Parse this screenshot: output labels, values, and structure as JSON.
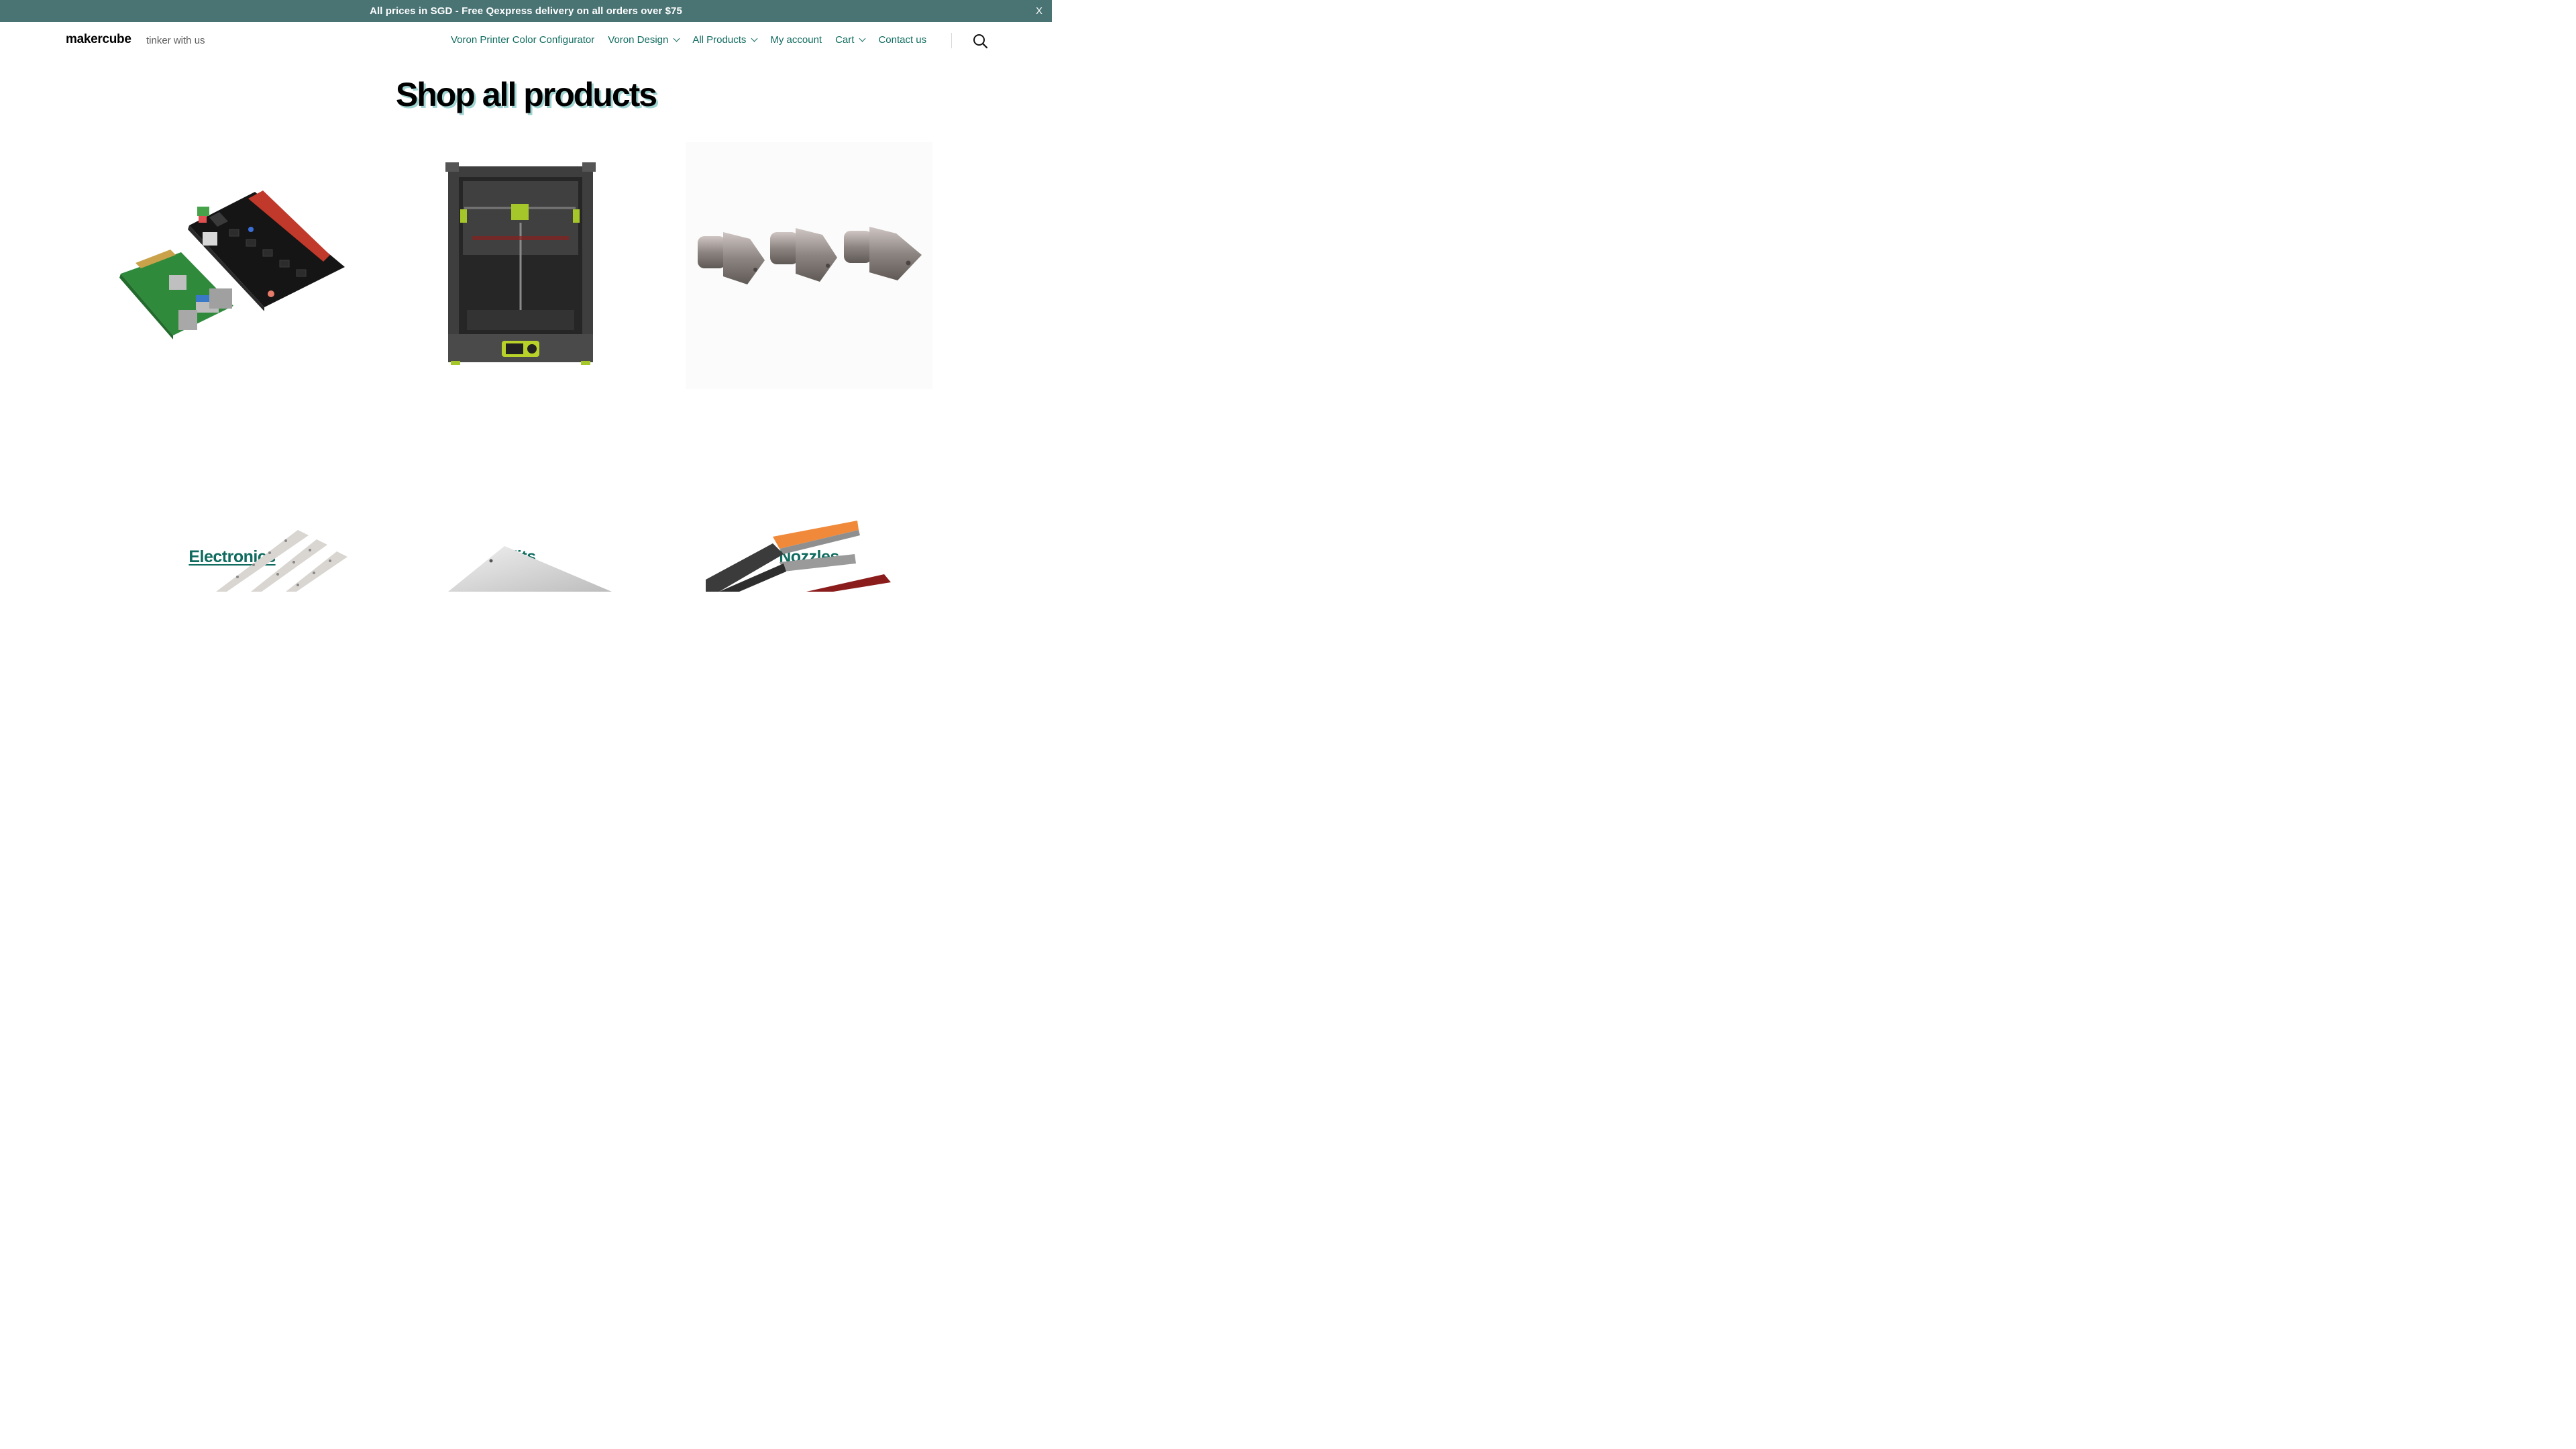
{
  "banner": {
    "text": "All prices in SGD - Free Qexpress delivery on all orders over $75",
    "close_label": "X",
    "color": "#4a7374"
  },
  "header": {
    "brand": "makercube",
    "tagline": "tinker with us",
    "nav": [
      {
        "label": "Voron Printer Color Configurator",
        "has_dropdown": false
      },
      {
        "label": "Voron Design",
        "has_dropdown": true
      },
      {
        "label": "All Products",
        "has_dropdown": true
      },
      {
        "label": "My account",
        "has_dropdown": false
      },
      {
        "label": "Cart",
        "has_dropdown": true
      },
      {
        "label": "Contact us",
        "has_dropdown": false
      }
    ],
    "search_icon": "search-icon",
    "link_color": "#0f6b5f"
  },
  "main": {
    "title": "Shop all products",
    "categories": [
      {
        "label": "Electronics",
        "image": "circuit-board-image"
      },
      {
        "label": "Kits",
        "image": "3d-printer-kit-image"
      },
      {
        "label": "Nozzles",
        "image": "nozzles-image"
      },
      {
        "label": "",
        "image": "rails-image"
      },
      {
        "label": "",
        "image": "sheet-image"
      },
      {
        "label": "",
        "image": "crimping-tool-image"
      }
    ]
  }
}
